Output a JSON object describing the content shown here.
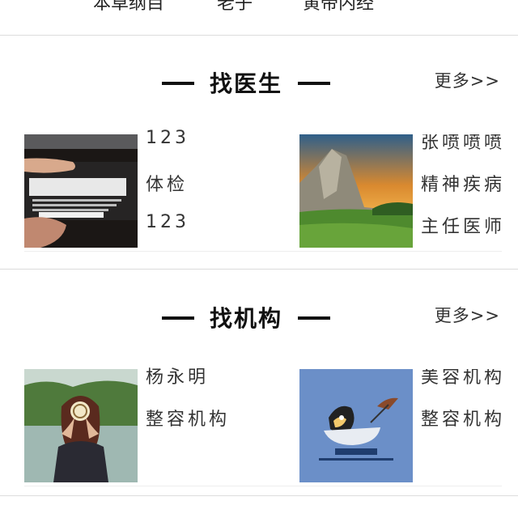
{
  "top_tabs": [
    "本草纲目",
    "老子",
    "黄帝内经"
  ],
  "doctor_section": {
    "title": "找医生",
    "more": "更多>>",
    "cards": [
      {
        "lines": [
          "123",
          "体检",
          "123"
        ]
      },
      {
        "lines": [
          "张喷喷喷",
          "精神疾病",
          "主任医师"
        ]
      }
    ]
  },
  "org_section": {
    "title": "找机构",
    "more": "更多>>",
    "cards": [
      {
        "lines": [
          "杨永明",
          "整容机构"
        ]
      },
      {
        "lines": [
          "美容机构",
          "整容机构"
        ]
      }
    ]
  },
  "colors": {
    "divider": "#dcdcdc",
    "title": "#111111",
    "text": "#333333"
  }
}
